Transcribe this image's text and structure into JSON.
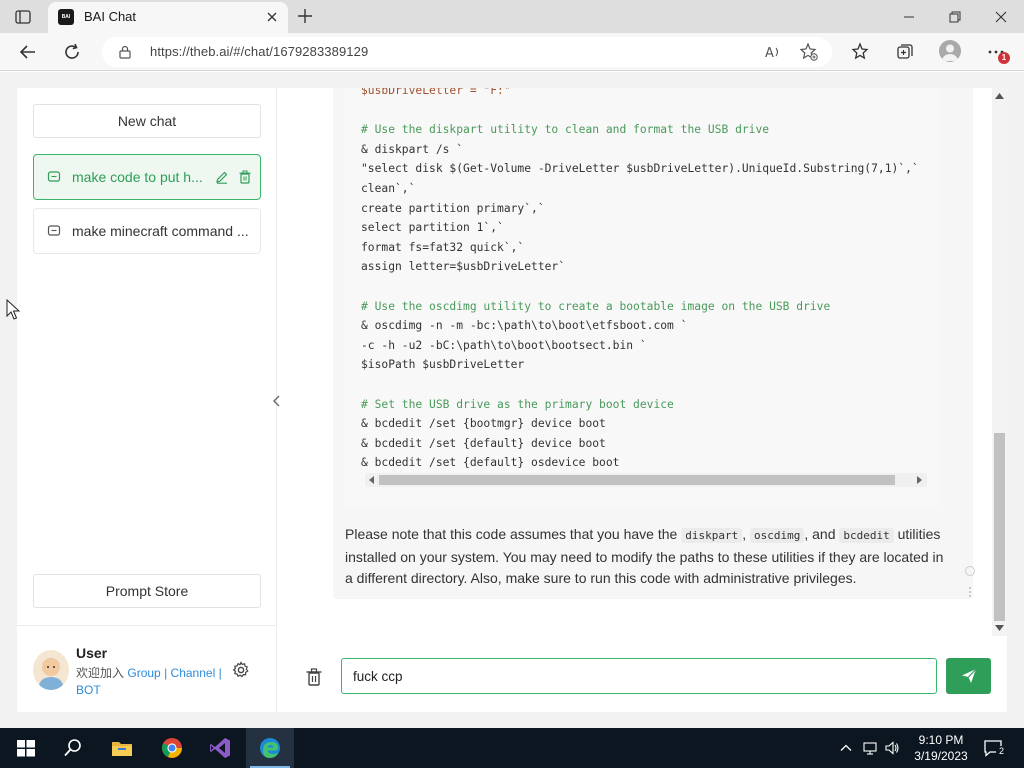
{
  "browser": {
    "tab_title": "BAI Chat",
    "favicon_text": "BAI",
    "url": "https://theb.ai/#/chat/1679283389129",
    "notification_badge": "1"
  },
  "sidebar": {
    "new_chat_label": "New chat",
    "chats": [
      {
        "label": "make code to put h...",
        "active": true
      },
      {
        "label": "make minecraft command ...",
        "active": false
      }
    ],
    "prompt_store_label": "Prompt Store",
    "user": {
      "name": "User",
      "join_prefix": "欢迎加入",
      "links": [
        "Group",
        "Channel",
        "BOT"
      ],
      "separator": "|"
    }
  },
  "message": {
    "code_lines": [
      {
        "text": "$usbDriveLetter = \"F:\"",
        "kind": "var"
      },
      {
        "text": "",
        "kind": "plain"
      },
      {
        "text": "# Use the diskpart utility to clean and format the USB drive",
        "kind": "comment"
      },
      {
        "text": "& diskpart /s `",
        "kind": "plain"
      },
      {
        "text": "\"select disk $(Get-Volume -DriveLetter $usbDriveLetter).UniqueId.Substring(7,1)`,`",
        "kind": "plain"
      },
      {
        "text": "clean`,`",
        "kind": "plain"
      },
      {
        "text": "create partition primary`,`",
        "kind": "plain"
      },
      {
        "text": "select partition 1`,`",
        "kind": "plain"
      },
      {
        "text": "format fs=fat32 quick`,`",
        "kind": "plain"
      },
      {
        "text": "assign letter=$usbDriveLetter`",
        "kind": "plain"
      },
      {
        "text": "",
        "kind": "plain"
      },
      {
        "text": "# Use the oscdimg utility to create a bootable image on the USB drive",
        "kind": "comment"
      },
      {
        "text": "& oscdimg -n -m -bc:\\path\\to\\boot\\etfsboot.com `",
        "kind": "plain"
      },
      {
        "text": "-c -h -u2 -bC:\\path\\to\\boot\\bootsect.bin `",
        "kind": "plain"
      },
      {
        "text": "$isoPath $usbDriveLetter",
        "kind": "plain"
      },
      {
        "text": "",
        "kind": "plain"
      },
      {
        "text": "# Set the USB drive as the primary boot device",
        "kind": "comment"
      },
      {
        "text": "& bcdedit /set {bootmgr} device boot",
        "kind": "plain"
      },
      {
        "text": "& bcdedit /set {default} device boot",
        "kind": "plain"
      },
      {
        "text": "& bcdedit /set {default} osdevice boot",
        "kind": "plain"
      }
    ],
    "note_part1": "Please note that this code assumes that you have the ",
    "code_diskpart": "diskpart",
    "sep1": ", ",
    "code_oscdimg": "oscdimg",
    "sep2": ", and ",
    "code_bcdedit": "bcdedit",
    "note_part2": " utilities installed on your system. You may need to modify the paths to these utilities if they are located in a different directory. Also, make sure to run this code with administrative privileges."
  },
  "input": {
    "value": "fuck ccp"
  },
  "taskbar": {
    "time": "9:10 PM",
    "date": "3/19/2023",
    "notification_count": "2"
  }
}
